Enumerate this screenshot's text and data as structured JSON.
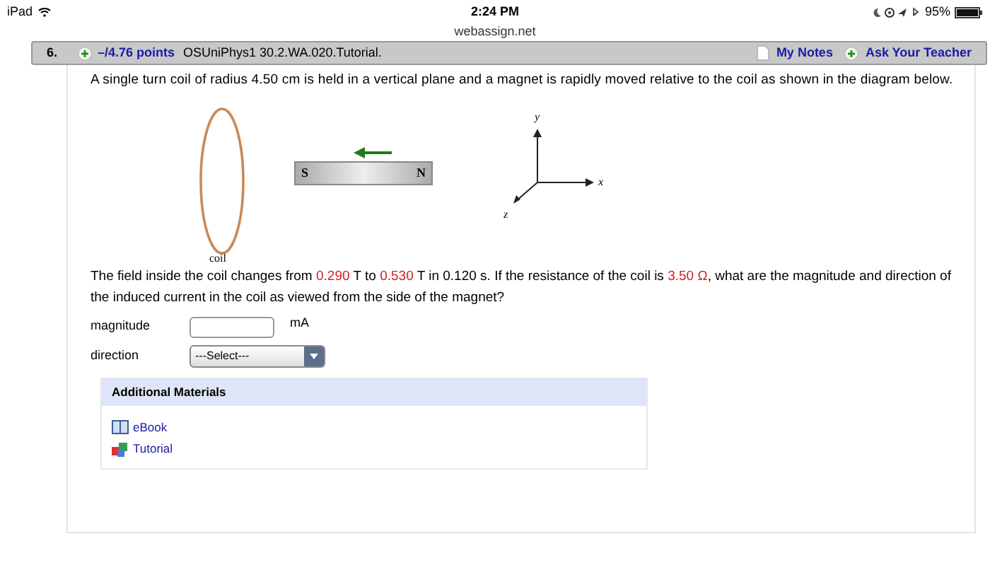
{
  "status_bar": {
    "device": "iPad",
    "time": "2:24 PM",
    "url": "webassign.net",
    "battery": "95%"
  },
  "question": {
    "number": "6.",
    "points": "–/4.76 points",
    "code": "OSUniPhys1 30.2.WA.020.Tutorial.",
    "my_notes": "My Notes",
    "ask_teacher": "Ask Your Teacher"
  },
  "intro": "A single turn coil of radius 4.50 cm is held in a vertical plane and a magnet is rapidly moved relative to the coil as shown in the diagram below.",
  "diagram": {
    "coil_label": "coil",
    "magnet_left": "S",
    "magnet_right": "N",
    "axis_y": "y",
    "axis_x": "x",
    "axis_z": "z"
  },
  "prompt": [
    {
      "kind": "text",
      "text": "The field inside the coil changes from "
    },
    {
      "kind": "value",
      "text": "0.290"
    },
    {
      "kind": "text",
      "text": " T to "
    },
    {
      "kind": "value",
      "text": "0.530"
    },
    {
      "kind": "text",
      "text": " T in 0.120 s. If the resistance of the coil is "
    },
    {
      "kind": "value",
      "text": "3.50 Ω"
    },
    {
      "kind": "text",
      "text": ", what are the magnitude and direction of the induced current in the coil as viewed from the side of the magnet?"
    }
  ],
  "magnitude": {
    "label": "magnitude",
    "unit": "mA"
  },
  "direction": {
    "label": "direction",
    "value": "---Select---"
  },
  "additional_materials": {
    "title": "Additional Materials",
    "links": [
      {
        "kind": "book",
        "label": "eBook"
      },
      {
        "kind": "tutorial",
        "label": "Tutorial"
      }
    ]
  }
}
